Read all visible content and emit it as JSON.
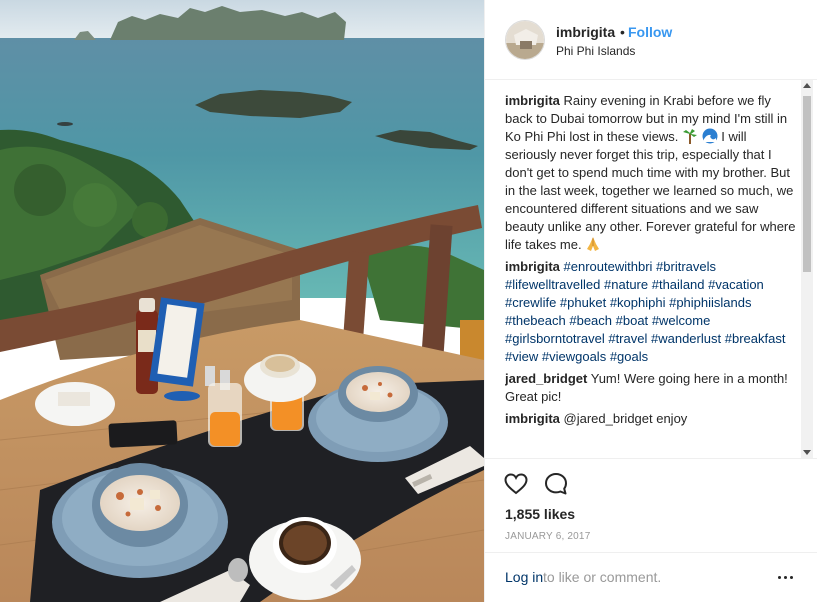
{
  "header": {
    "username": "imbrigita",
    "dot": "•",
    "follow_label": "Follow",
    "location": "Phi Phi Islands"
  },
  "caption": {
    "username": "imbrigita",
    "text_part1": "Rainy evening in Krabi before we fly back to Dubai tomorrow but in my mind I'm still in Ko Phi Phi lost in these views.",
    "text_part2": "I will seriously never forget this trip, especially that I don't get to spend much time with my brother. But in the last week, together we learned so much, we encountered different situations and we saw beauty unlike any other. Forever grateful for where life takes me.",
    "emojis": [
      "palm-tree-emoji",
      "wave-emoji",
      "folded-hands-emoji"
    ]
  },
  "hashtag_comment": {
    "username": "imbrigita",
    "tags": [
      "#enroutewithbri",
      "#britravels",
      "#lifewelltravelled",
      "#nature",
      "#thailand",
      "#vacation",
      "#crewlife",
      "#phuket",
      "#kophiphi",
      "#phiphiislands",
      "#thebeach",
      "#beach",
      "#boat",
      "#welcome",
      "#girlsborntotravel",
      "#travel",
      "#wanderlust",
      "#breakfast",
      "#view",
      "#viewgoals",
      "#goals"
    ]
  },
  "comments": [
    {
      "username": "jared_bridget",
      "text": "Yum! Were going here in a month! Great pic!"
    },
    {
      "username": "imbrigita",
      "text": "@jared_bridget enjoy"
    }
  ],
  "actions": {
    "like_icon": "heart-icon",
    "comment_icon": "speech-bubble-icon",
    "likes": "1,855 likes",
    "date": "JANUARY 6, 2017"
  },
  "footer": {
    "login_label": "Log in",
    "login_rest": "to like or comment.",
    "more_icon": "more-options-icon"
  },
  "colors": {
    "link": "#3897f0",
    "hashtag": "#003569",
    "muted": "#999999",
    "text": "#262626"
  }
}
